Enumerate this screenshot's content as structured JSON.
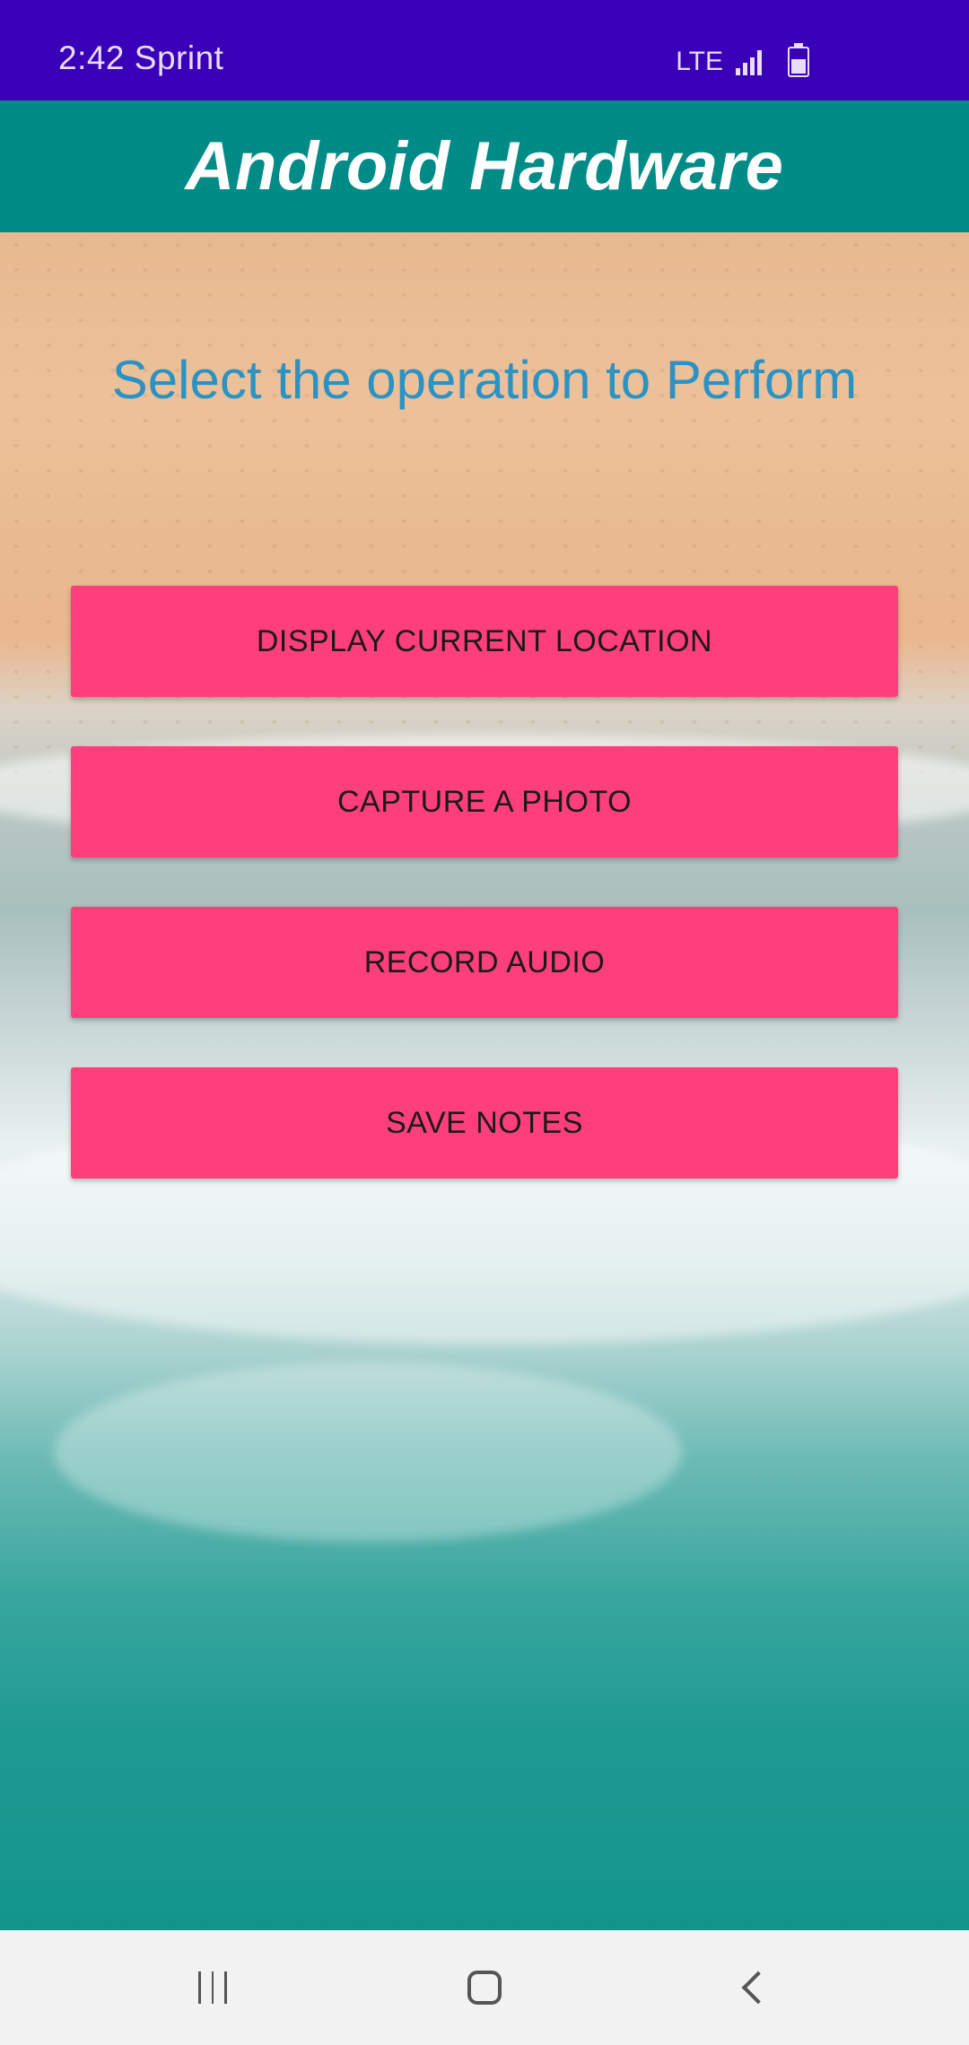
{
  "status_bar": {
    "time_carrier": "2:42 Sprint",
    "network": "LTE"
  },
  "app_bar": {
    "title": "Android Hardware"
  },
  "main": {
    "heading": "Select the operation to Perform",
    "buttons": [
      {
        "label": "DISPLAY CURRENT LOCATION"
      },
      {
        "label": "CAPTURE A PHOTO"
      },
      {
        "label": "RECORD AUDIO"
      },
      {
        "label": "SAVE NOTES"
      }
    ]
  },
  "colors": {
    "status_bar": "#3a00b8",
    "app_bar": "#008b87",
    "button": "#fe3f7c",
    "heading": "#2b93c4"
  },
  "nav_bar": {
    "icons": [
      "recents-icon",
      "home-icon",
      "back-icon"
    ]
  }
}
